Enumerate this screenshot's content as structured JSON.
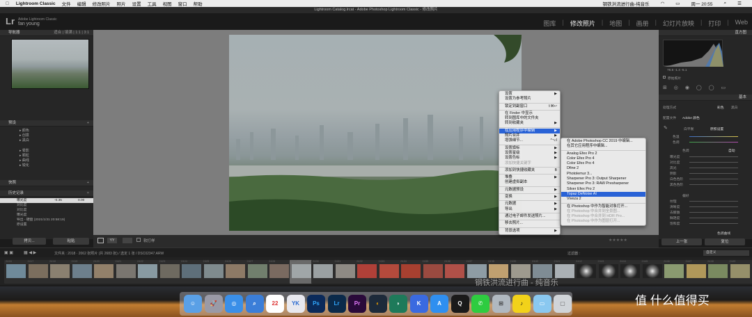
{
  "menubar": {
    "app": "Lightroom Classic",
    "items": [
      "文件",
      "编辑",
      "修改照片",
      "照片",
      "设置",
      "工具",
      "视图",
      "窗口",
      "帮助"
    ],
    "now_playing": "钢铁洪流进行曲-纯音乐",
    "clock": "周一 20:55"
  },
  "window_title": "Lightroom Catalog.lrcat - Adobe Photoshop Lightroom Classic - 修改照片",
  "lr": {
    "logo": "Lr",
    "sub1": "Adobe Lightroom Classic",
    "user": "fan young",
    "modules": [
      "图库",
      "修改照片",
      "地图",
      "画册",
      "幻灯片放映",
      "打印",
      "Web"
    ],
    "active_module": "修改照片"
  },
  "left": {
    "navigator": {
      "title": "导航器",
      "opts": "适合 | 填满 | 1:1 | 3:1"
    },
    "presets": {
      "title": "预设",
      "items": [
        "颜色",
        "创意",
        "黑白",
        "晕影",
        "颗粒",
        "曲线",
        "锐化"
      ]
    },
    "snapshots": {
      "title": "快照"
    },
    "history": {
      "title": "历史记录",
      "rows": [
        {
          "name": "曝光度",
          "v1": "-0.35",
          "v2": "0.00"
        },
        {
          "name": "对比度",
          "v1": "",
          "v2": ""
        },
        {
          "name": "对比度",
          "v1": "",
          "v2": ""
        },
        {
          "name": "曝光度",
          "v1": "",
          "v2": ""
        },
        {
          "name": "导出 - 硬盘 (2021/1/31 20:58:19)",
          "v1": "",
          "v2": ""
        },
        {
          "name": "原设置",
          "v1": "",
          "v2": ""
        }
      ]
    },
    "copy_btn": "拷贝...",
    "paste_btn": "粘贴"
  },
  "toolbar": {
    "softproof": "软打样"
  },
  "right": {
    "histogram_title": "直方图",
    "hist_readout": "76.6   -1.4   -5.1",
    "original_photo": "原始照片",
    "basic_title": "基本",
    "treatment": "处理方式",
    "treatment_color": "彩色",
    "treatment_bw": "黑白",
    "profile_label": "配置文件",
    "profile_value": "Adobe 颜色",
    "wb_label": "白平衡",
    "wb_value": "原照设置",
    "temp": "色温",
    "tint": "色调",
    "tone": "色调",
    "auto": "自动",
    "tone_rows": [
      "曝光度",
      "对比度",
      "高光",
      "阴影",
      "白色色阶",
      "黑色色阶"
    ],
    "presence": "偏好",
    "presence_rows": [
      "纹理",
      "清晰度",
      "去朦胧",
      "鲜艳度",
      "饱和度"
    ],
    "tone_curve": "色调曲线",
    "prev_btn": "上一张",
    "reset_btn": "复位"
  },
  "filmstrip": {
    "info": "文件夹 : 2018 · 2062 张照片 (共 2683 张) / 选定 1 张 / DSC02347.ARW",
    "filter": "过滤器 :",
    "filter_value": "自定义",
    "numbers": [
      "2416",
      "2417",
      "2418",
      "2419",
      "2420",
      "2421",
      "2422",
      "2423",
      "2424",
      "2425",
      "2426",
      "2427",
      "2428",
      "2429",
      "2430",
      "2431",
      "2432",
      "2433",
      "2434",
      "2435",
      "2436",
      "2437",
      "2438",
      "2439",
      "2440",
      "2441",
      "2442",
      "2443",
      "2444",
      "2445",
      "2446",
      "2447",
      "2448",
      "2449"
    ],
    "selected_index": 13
  },
  "watermark": "钢铁洪流进行曲 - 纯音乐",
  "smzdm": "值 什么值得买",
  "dock_icons": [
    "Finder",
    "Launchpad",
    "Safari",
    "Search",
    "22",
    "YOUKU",
    "Ps",
    "Lr",
    "Pr",
    "DaVinci",
    "Moon",
    "K",
    "AppStore",
    "QQ",
    "WeChat",
    "Calc",
    "Music",
    "Folder",
    "Trash"
  ],
  "menu1": {
    "items": [
      {
        "label": "设置",
        "arrow": true
      },
      {
        "label": "设置为参考照片"
      },
      {
        "sep": true
      },
      {
        "label": "锁定到副窗口",
        "shortcut": "⇧⌘↩"
      },
      {
        "sep": true
      },
      {
        "label": "在 Finder 中显示"
      },
      {
        "label": "转到图库中的文件夹"
      },
      {
        "label": "转到收藏夹",
        "arrow": true
      },
      {
        "sep": true
      },
      {
        "label": "在应用程序中编辑",
        "arrow": true,
        "hl": true
      },
      {
        "label": "照片合并",
        "arrow": true
      },
      {
        "label": "增强细节...",
        "shortcut": "^⌥I"
      },
      {
        "sep": true
      },
      {
        "label": "设置旗标",
        "arrow": true
      },
      {
        "label": "设置星级",
        "arrow": true
      },
      {
        "label": "设置色标",
        "arrow": true
      },
      {
        "label": "添加快捷关键字",
        "dis": true
      },
      {
        "sep": true
      },
      {
        "label": "添加到快捷收藏夹",
        "shortcut": "B"
      },
      {
        "sep": true
      },
      {
        "label": "堆叠",
        "arrow": true
      },
      {
        "label": "创建虚拟副本"
      },
      {
        "sep": true
      },
      {
        "label": "元数据预设",
        "arrow": true
      },
      {
        "sep": true
      },
      {
        "label": "变换",
        "arrow": true
      },
      {
        "sep": true
      },
      {
        "label": "元数据",
        "arrow": true
      },
      {
        "label": "导出",
        "arrow": true
      },
      {
        "sep": true
      },
      {
        "label": "通过电子邮件发送照片..."
      },
      {
        "sep": true
      },
      {
        "label": "移去照片..."
      },
      {
        "sep": true
      },
      {
        "label": "背景选项",
        "arrow": true
      }
    ]
  },
  "menu2": {
    "items": [
      {
        "label": "在 Adobe Photoshop CC 2019 中编辑..."
      },
      {
        "label": "在其它应用程序中编辑..."
      },
      {
        "sep": true
      },
      {
        "label": "Analog Efex Pro 2"
      },
      {
        "label": "Color Efex Pro 4"
      },
      {
        "label": "Color Efex Pro 4"
      },
      {
        "label": "Dfine 2"
      },
      {
        "label": "Photolemur 3..."
      },
      {
        "label": "Sharpener Pro 3: Output Sharpener"
      },
      {
        "label": "Sharpener Pro 3: RAW Presharpener"
      },
      {
        "label": "Silver Efex Pro 2"
      },
      {
        "label": "Topaz DeNoise AI",
        "hl": true
      },
      {
        "label": "Viveza 2"
      },
      {
        "sep": true
      },
      {
        "label": "在 Photoshop 中作为智能对象打开..."
      },
      {
        "label": "在 Photoshop 中合并到全景图...",
        "dis": true
      },
      {
        "label": "在 Photoshop 中合并到 HDR Pro...",
        "dis": true
      },
      {
        "label": "在 Photoshop 中作为图层打开...",
        "dis": true
      }
    ]
  }
}
